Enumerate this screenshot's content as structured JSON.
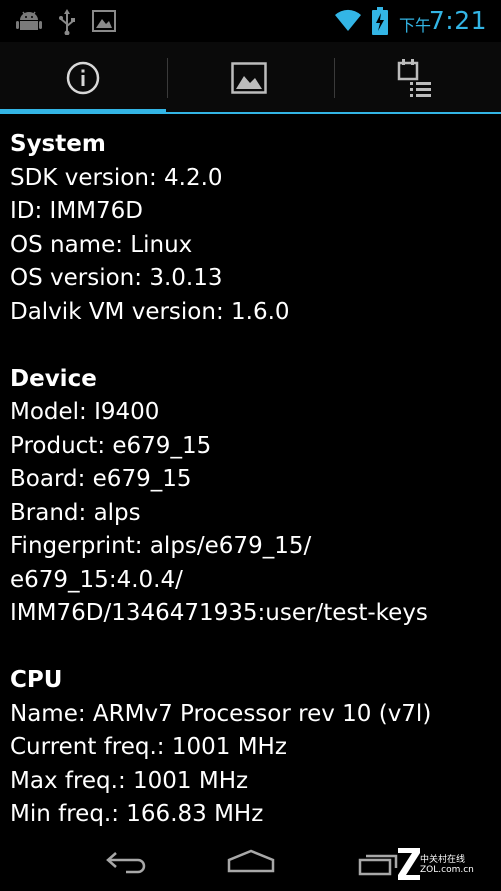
{
  "status_bar": {
    "time": "7:21",
    "am_pm": "下午",
    "accent_color": "#33b5e5",
    "left_icons": [
      "android-debug-icon",
      "usb-icon",
      "photo-notification-icon"
    ],
    "right_icons": [
      "wifi-icon",
      "battery-charging-icon"
    ]
  },
  "tabs": [
    {
      "icon": "info-icon",
      "selected": true
    },
    {
      "icon": "image-icon",
      "selected": false
    },
    {
      "icon": "task-list-icon",
      "selected": false
    }
  ],
  "sections": [
    {
      "title": "System",
      "rows": [
        "SDK version: 4.2.0",
        "ID: IMM76D",
        "OS name: Linux",
        "OS version: 3.0.13",
        "Dalvik VM version: 1.6.0"
      ]
    },
    {
      "title": "Device",
      "rows": [
        "Model: I9400",
        "Product: e679_15",
        "Board: e679_15",
        "Brand: alps",
        "Fingerprint: alps/e679_15/",
        "e679_15:4.0.4/",
        "IMM76D/1346471935:user/test-keys"
      ]
    },
    {
      "title": "CPU",
      "rows": [
        "Name: ARMv7 Processor rev 10 (v7l)",
        "Current freq.: 1001 MHz",
        "Max freq.: 1001 MHz",
        "Min freq.: 166.83 MHz"
      ]
    }
  ],
  "nav_bar": {
    "buttons": [
      "back-icon",
      "home-icon",
      "recent-apps-icon"
    ]
  },
  "watermark": {
    "logo": "Z",
    "line1": "中关村在线",
    "line2": "ZOL.com.cn"
  }
}
